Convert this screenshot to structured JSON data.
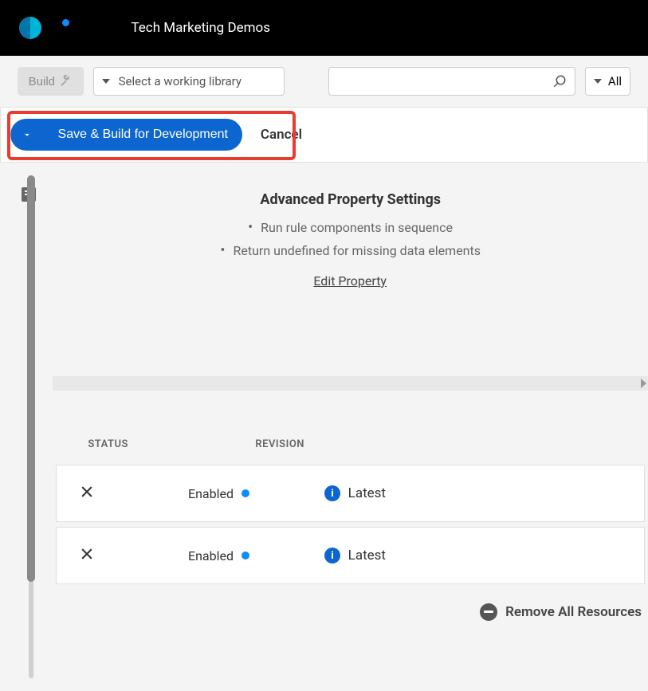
{
  "header": {
    "tenant": "Tech Marketing Demos"
  },
  "toolbar": {
    "build_label": "Build",
    "library_placeholder": "Select a working library",
    "search_placeholder": "",
    "filter_label": "All"
  },
  "action_bar": {
    "save_build_label": "Save & Build for Development",
    "cancel_label": "Cancel"
  },
  "advanced": {
    "title": "Advanced Property Settings",
    "items": [
      "Run rule components in sequence",
      "Return undefined for missing data elements"
    ],
    "edit_link": "Edit Property"
  },
  "table": {
    "headers": {
      "status": "STATUS",
      "revision": "REVISION"
    },
    "rows": [
      {
        "status": "Enabled",
        "revision": "Latest"
      },
      {
        "status": "Enabled",
        "revision": "Latest"
      }
    ],
    "remove_all": "Remove All Resources"
  }
}
